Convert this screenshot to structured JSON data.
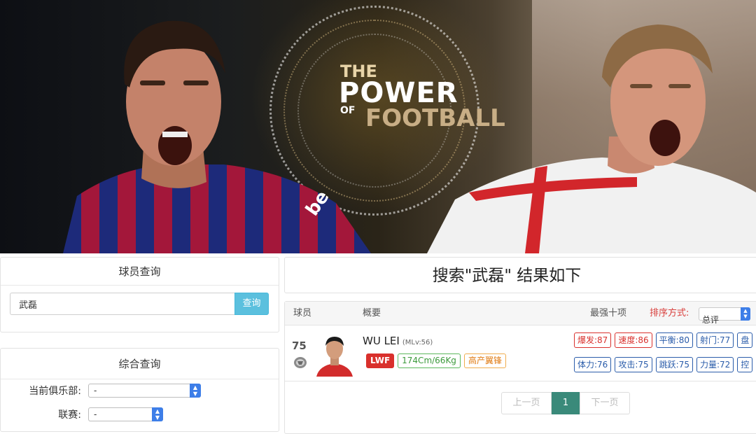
{
  "hero": {
    "logo_line1": "THE",
    "logo_line2": "POWER",
    "logo_line3_a": "OF",
    "logo_line3_b": "FOOTBALL",
    "left_shirt_text": "be"
  },
  "search": {
    "title": "球员查询",
    "input_value": "武磊",
    "button_label": "查询"
  },
  "filter": {
    "title": "综合查询",
    "club_label": "当前俱乐部:",
    "club_value": "-",
    "league_label": "联赛:",
    "league_value": "-"
  },
  "result": {
    "title": "搜索\"武磊\" 结果如下"
  },
  "table": {
    "col_player": "球员",
    "col_summary": "概要",
    "col_top10": "最强十项",
    "sort_label": "排序方式:",
    "sort_value": "总评"
  },
  "player": {
    "rating": "75",
    "name": "WU LEI",
    "level": "(MLv:56)",
    "position": "LWF",
    "body": "174Cm/66Kg",
    "style": "高产翼锋",
    "stats_row1": [
      "爆发:87",
      "速度:86",
      "平衡:80",
      "射门:77",
      "盘"
    ],
    "stats_row2": [
      "体力:76",
      "攻击:75",
      "跳跃:75",
      "力量:72",
      "控"
    ]
  },
  "pagination": {
    "prev_label": "上一页",
    "current_page": "1",
    "next_label": "下一页"
  },
  "colors": {
    "query_button": "#5bc0de",
    "sort_label": "#d9403d",
    "position_tag": "#d9302c",
    "current_page": "#3a8a7a",
    "select_caret": "#3d7ee8"
  }
}
